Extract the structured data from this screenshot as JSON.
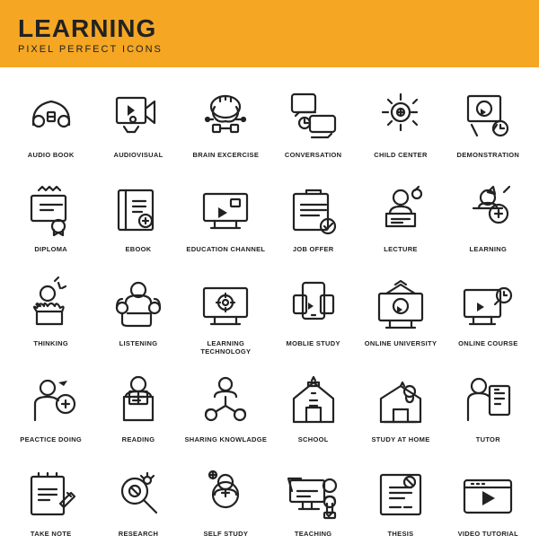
{
  "header": {
    "title": "LEARNING",
    "subtitle": "PIXEL PERFECT ICONS"
  },
  "icons": [
    {
      "id": "audio-book",
      "label": "AUDIO BOOK"
    },
    {
      "id": "audiovisual",
      "label": "AUDIOVISUAL"
    },
    {
      "id": "brain-exercise",
      "label": "BRAIN EXCERCISE"
    },
    {
      "id": "conversation",
      "label": "CONVERSATION"
    },
    {
      "id": "child-center",
      "label": "CHILD CENTER"
    },
    {
      "id": "demonstration",
      "label": "DEMONSTRATION"
    },
    {
      "id": "diploma",
      "label": "DIPLOMA"
    },
    {
      "id": "ebook",
      "label": "EBOOK"
    },
    {
      "id": "education-channel",
      "label": "EDUCATION CHANNEL"
    },
    {
      "id": "job-offer",
      "label": "JOB OFFER"
    },
    {
      "id": "lecture",
      "label": "LECTURE"
    },
    {
      "id": "learning",
      "label": "LEARNING"
    },
    {
      "id": "thinking",
      "label": "THINKING"
    },
    {
      "id": "listening",
      "label": "LISTENING"
    },
    {
      "id": "learning-technology",
      "label": "LEARNING TECHNOLOGY"
    },
    {
      "id": "mobile-study",
      "label": "MOBLIE STUDY"
    },
    {
      "id": "online-university",
      "label": "ONLINE UNIVERSITY"
    },
    {
      "id": "online-course",
      "label": "ONLINE COURSE"
    },
    {
      "id": "practice-doing",
      "label": "PEACTICE DOING"
    },
    {
      "id": "reading",
      "label": "READING"
    },
    {
      "id": "sharing-knowledge",
      "label": "SHARING KNOWLADGE"
    },
    {
      "id": "school",
      "label": "SCHOOL"
    },
    {
      "id": "study-at-home",
      "label": "STUDY AT HOME"
    },
    {
      "id": "tutor",
      "label": "TUTOR"
    },
    {
      "id": "take-note",
      "label": "TAKE NOTE"
    },
    {
      "id": "research",
      "label": "RESEARCH"
    },
    {
      "id": "self-study",
      "label": "SELF STUDY"
    },
    {
      "id": "teaching",
      "label": "TEACHING"
    },
    {
      "id": "thesis",
      "label": "THESIS"
    },
    {
      "id": "video-tutorial",
      "label": "VIDEO TUTORIAL"
    }
  ]
}
